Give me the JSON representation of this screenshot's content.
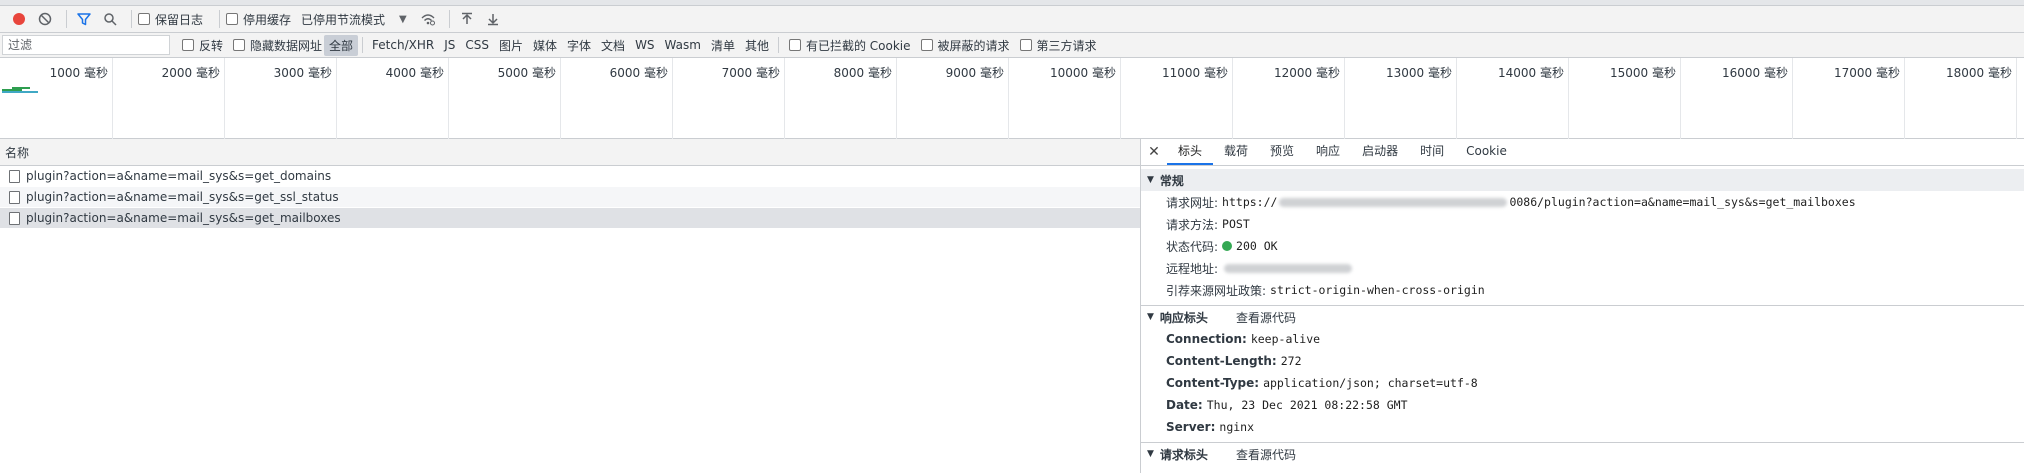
{
  "toolbar": {
    "preserve_log": "保留日志",
    "disable_cache": "停用缓存",
    "throttling": "已停用节流模式",
    "colors": {
      "record": "#e8453c",
      "filter": "#1a73e8"
    }
  },
  "filter": {
    "placeholder": "过滤",
    "invert": "反转",
    "hide_data_urls": "隐藏数据网址",
    "types": [
      "全部",
      "Fetch/XHR",
      "JS",
      "CSS",
      "图片",
      "媒体",
      "字体",
      "文档",
      "WS",
      "Wasm",
      "清单",
      "其他"
    ],
    "blocked_cookies": "有已拦截的 Cookie",
    "blocked_requests": "被屏蔽的请求",
    "third_party": "第三方请求"
  },
  "overview": {
    "ticks": [
      "1000 毫秒",
      "2000 毫秒",
      "3000 毫秒",
      "4000 毫秒",
      "5000 毫秒",
      "6000 毫秒",
      "7000 毫秒",
      "8000 毫秒",
      "9000 毫秒",
      "10000 毫秒",
      "11000 毫秒",
      "12000 毫秒",
      "13000 毫秒",
      "14000 毫秒",
      "15000 毫秒",
      "16000 毫秒",
      "17000 毫秒",
      "18000 毫秒"
    ]
  },
  "list": {
    "header": "名称",
    "rows": [
      "plugin?action=a&name=mail_sys&s=get_domains",
      "plugin?action=a&name=mail_sys&s=get_ssl_status",
      "plugin?action=a&name=mail_sys&s=get_mailboxes"
    ]
  },
  "details": {
    "tabs": [
      "标头",
      "载荷",
      "预览",
      "响应",
      "启动器",
      "时间",
      "Cookie"
    ],
    "general": {
      "title": "常规",
      "request_url_label": "请求网址:",
      "request_url_prefix": "https://",
      "request_url_suffix": "0086/plugin?action=a&name=mail_sys&s=get_mailboxes",
      "method_label": "请求方法:",
      "method": "POST",
      "status_label": "状态代码:",
      "status": "200 OK",
      "remote_label": "远程地址:",
      "referrer_label": "引荐来源网址政策:",
      "referrer": "strict-origin-when-cross-origin"
    },
    "response_headers": {
      "title": "响应标头",
      "view_source": "查看源代码",
      "items": [
        {
          "k": "Connection:",
          "v": "keep-alive"
        },
        {
          "k": "Content-Length:",
          "v": "272"
        },
        {
          "k": "Content-Type:",
          "v": "application/json; charset=utf-8"
        },
        {
          "k": "Date:",
          "v": "Thu, 23 Dec 2021 08:22:58 GMT"
        },
        {
          "k": "Server:",
          "v": "nginx"
        }
      ]
    },
    "request_headers": {
      "title": "请求标头",
      "view_source": "查看源代码"
    }
  }
}
